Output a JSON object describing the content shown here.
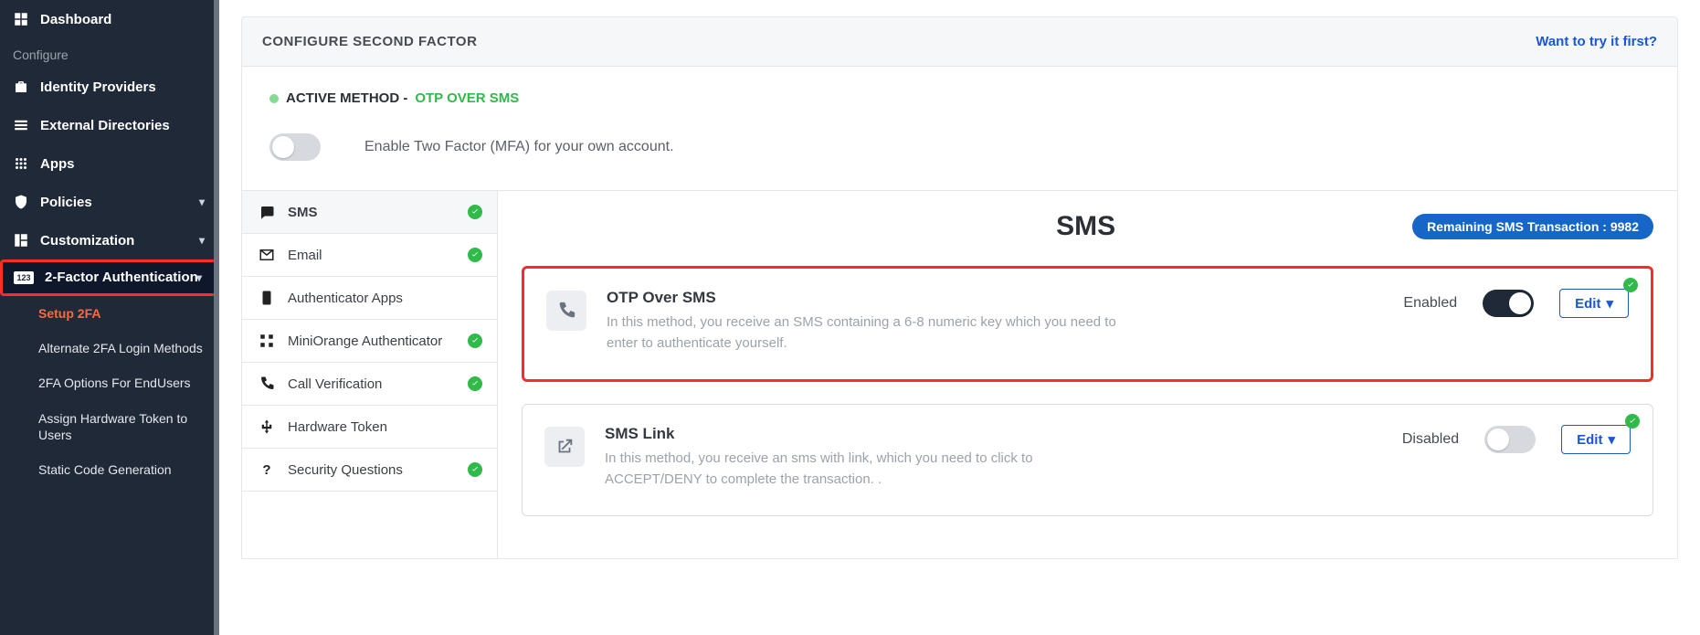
{
  "sidebar": {
    "dashboard": "Dashboard",
    "configure_label": "Configure",
    "identity_providers": "Identity Providers",
    "external_directories": "External Directories",
    "apps": "Apps",
    "policies": "Policies",
    "customization": "Customization",
    "two_factor": "2-Factor Authentication",
    "sub": {
      "setup": "Setup 2FA",
      "alternate": "Alternate 2FA Login Methods",
      "endusers": "2FA Options For EndUsers",
      "assign_token": "Assign Hardware Token to Users",
      "static_code": "Static Code Generation"
    }
  },
  "header": {
    "title": "CONFIGURE SECOND FACTOR",
    "try_link": "Want to try it first?"
  },
  "active_method": {
    "label": "ACTIVE METHOD - ",
    "value": "OTP OVER SMS"
  },
  "enable_toggle_text": "Enable Two Factor (MFA) for your own account.",
  "categories": {
    "sms": "SMS",
    "email": "Email",
    "auth_apps": "Authenticator Apps",
    "miniorange": "MiniOrange Authenticator",
    "call": "Call Verification",
    "hardware": "Hardware Token",
    "security_q": "Security Questions"
  },
  "content": {
    "heading": "SMS",
    "badge_label": "Remaining SMS Transaction : ",
    "badge_value": "9982",
    "methods": [
      {
        "title": "OTP Over SMS",
        "desc": "In this method, you receive an SMS containing a 6-8 numeric key which you need to enter to authenticate yourself.",
        "state": "Enabled",
        "toggle_on": true,
        "edit": "Edit",
        "highlight": true
      },
      {
        "title": "SMS Link",
        "desc": "In this method, you receive an sms with link, which you need to click to ACCEPT/DENY to complete the transaction. .",
        "state": "Disabled",
        "toggle_on": false,
        "edit": "Edit",
        "highlight": false
      }
    ]
  }
}
